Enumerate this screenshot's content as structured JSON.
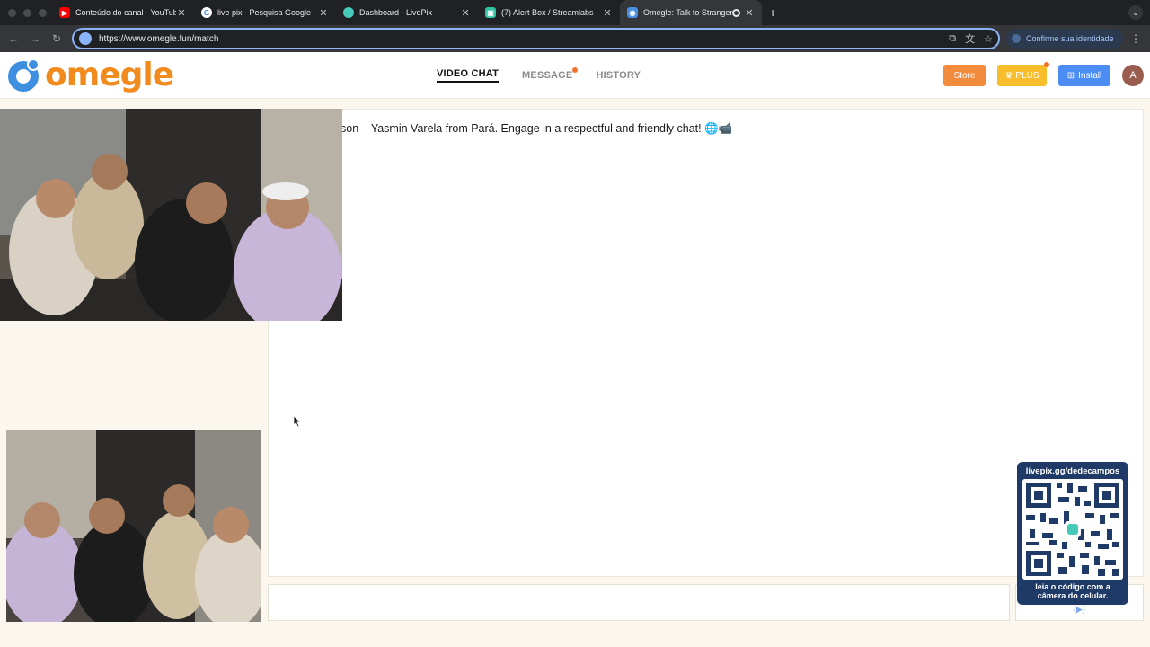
{
  "browser": {
    "tabs": [
      {
        "title": "Conteúdo do canal - YouTube",
        "favicon": "youtube-icon",
        "color": "#ff0000"
      },
      {
        "title": "live pix - Pesquisa Google",
        "favicon": "google-icon",
        "color": "#4285f4"
      },
      {
        "title": "Dashboard - LivePix",
        "favicon": "livepix-icon",
        "color": "#45c9b8"
      },
      {
        "title": "(7) Alert Box / Streamlabs",
        "favicon": "streamlabs-icon",
        "color": "#31c3a2"
      },
      {
        "title": "Omegle: Talk to Strangers",
        "favicon": "omegle-icon",
        "color": "#4a90e2"
      }
    ],
    "active_tab": 4,
    "url": "https://www.omegle.fun/match",
    "identity_label": "Confirme sua identidade"
  },
  "header": {
    "logo_text": "omegle",
    "nav": [
      {
        "label": "VIDEO CHAT",
        "active": true
      },
      {
        "label": "MESSAGE",
        "notification": true
      },
      {
        "label": "HISTORY"
      }
    ],
    "store_label": "Store",
    "plus_label": "PLUS",
    "install_label": "Install",
    "avatar_initial": "A"
  },
  "chat": {
    "message": "son – Yasmin Varela from Pará. Engage in a respectful and friendly chat! 🌐📹"
  },
  "overlay": {
    "top_text": "livepix.gg/dedecampos",
    "bottom_text_1": "leia o código com a",
    "bottom_text_2": "câmera do celular."
  },
  "colors": {
    "accent_orange": "#f28b1e",
    "store": "#f28b3b",
    "plus": "#f7bd2a",
    "install": "#4b8df5"
  }
}
